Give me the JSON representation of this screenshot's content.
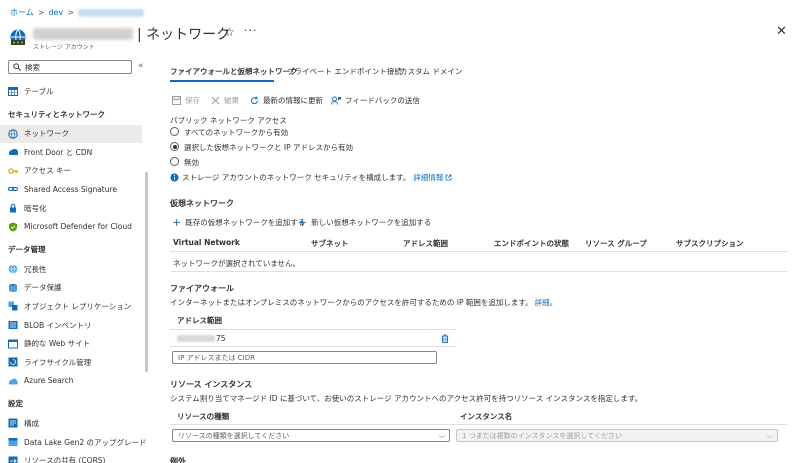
{
  "breadcrumb": {
    "home": "ホーム",
    "dev": "dev",
    "sep": ">"
  },
  "header": {
    "title_suffix": "| ネットワーク",
    "subtitle": "ストレージ アカウント",
    "star": "☆",
    "more": "···",
    "close": "✕"
  },
  "sidebar": {
    "search_placeholder": "検索",
    "collapse": "«",
    "top_items": [
      {
        "label": "テーブル",
        "icon": "table-icon"
      }
    ],
    "sections": [
      {
        "title": "セキュリティとネットワーク",
        "items": [
          {
            "label": "ネットワーク",
            "icon": "network-icon",
            "active": true
          },
          {
            "label": "Front Door と CDN",
            "icon": "front-door-icon"
          },
          {
            "label": "アクセス キー",
            "icon": "key-icon"
          },
          {
            "label": "Shared Access Signature",
            "icon": "link-icon"
          },
          {
            "label": "暗号化",
            "icon": "lock-icon"
          },
          {
            "label": "Microsoft Defender for Cloud",
            "icon": "shield-icon"
          }
        ]
      },
      {
        "title": "データ管理",
        "items": [
          {
            "label": "冗長性",
            "icon": "globe-icon"
          },
          {
            "label": "データ保護",
            "icon": "data-protection-icon"
          },
          {
            "label": "オブジェクト レプリケーション",
            "icon": "replication-icon"
          },
          {
            "label": "BLOB インベントリ",
            "icon": "inventory-icon"
          },
          {
            "label": "静的な Web サイト",
            "icon": "website-icon"
          },
          {
            "label": "ライフサイクル管理",
            "icon": "lifecycle-icon"
          },
          {
            "label": "Azure Search",
            "icon": "cloud-search-icon"
          }
        ]
      },
      {
        "title": "設定",
        "items": [
          {
            "label": "構成",
            "icon": "config-icon"
          },
          {
            "label": "Data Lake Gen2 のアップグレード",
            "icon": "datalake-icon"
          },
          {
            "label": "リソースの共有 (CORS)",
            "icon": "cors-icon"
          }
        ]
      }
    ]
  },
  "tabs": [
    {
      "label": "ファイアウォールと仮想ネットワーク",
      "active": true
    },
    {
      "label": "プライベート エンドポイント接続"
    },
    {
      "label": "カスタム ドメイン"
    }
  ],
  "toolbar": {
    "save": "保存",
    "discard": "破棄",
    "refresh": "最新の情報に更新",
    "feedback": "フィードバックの送信"
  },
  "public_access": {
    "title": "パブリック ネットワーク アクセス",
    "options": [
      {
        "label": "すべてのネットワークから有効",
        "checked": false
      },
      {
        "label": "選択した仮想ネットワークと IP アドレスから有効",
        "checked": true
      },
      {
        "label": "無効",
        "checked": false
      }
    ],
    "info_text": "ストレージ アカウントのネットワーク セキュリティを構成します。",
    "info_link": "詳細情報"
  },
  "vnet": {
    "title": "仮想ネットワーク",
    "add_existing": "既存の仮想ネットワークを追加する",
    "add_new": "新しい仮想ネットワークを追加する",
    "columns": [
      "Virtual Network",
      "サブネット",
      "アドレス範囲",
      "エンドポイントの状態",
      "リソース グループ",
      "サブスクリプション"
    ],
    "empty": "ネットワークが選択されていません。"
  },
  "firewall": {
    "title": "ファイアウォール",
    "desc": "インターネットまたはオンプレミスのネットワークからのアクセスを許可するための IP 範囲を追加します。",
    "desc_link": "詳細。",
    "col": "アドレス範囲",
    "ip_suffix": "75",
    "input_placeholder": "IP アドレスまたは CIDR"
  },
  "resource_instances": {
    "title": "リソース インスタンス",
    "desc": "システム割り当てマネージド ID に基づいて、お使いのストレージ アカウントへのアクセス許可を持つリソース インスタンスを指定します。",
    "col_type": "リソースの種類",
    "col_name": "インスタンス名",
    "type_placeholder": "リソースの種類を選択してください",
    "name_placeholder": "1 つまたは複数のインスタンスを選択してください"
  },
  "bottom_cut": "例外"
}
